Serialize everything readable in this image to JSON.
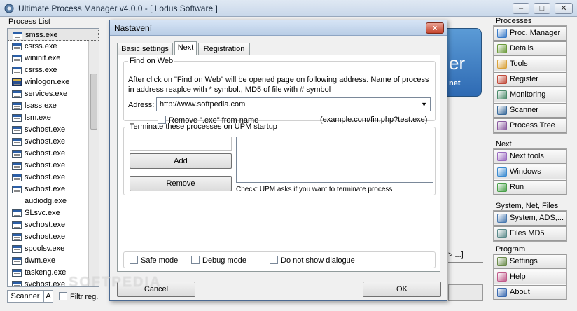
{
  "window": {
    "title": "Ultimate Process Manager v4.0.0 - [ Lodus Software ]"
  },
  "process_list": {
    "header": "Process List",
    "items": [
      {
        "name": "smss.exe",
        "icon": "process-icon"
      },
      {
        "name": "csrss.exe",
        "icon": "process-icon"
      },
      {
        "name": "wininit.exe",
        "icon": "process-icon"
      },
      {
        "name": "csrss.exe",
        "icon": "process-icon"
      },
      {
        "name": "winlogon.exe",
        "icon": "winlogon-icon"
      },
      {
        "name": "services.exe",
        "icon": "process-icon"
      },
      {
        "name": "lsass.exe",
        "icon": "process-icon"
      },
      {
        "name": "lsm.exe",
        "icon": "process-icon"
      },
      {
        "name": "svchost.exe",
        "icon": "process-icon"
      },
      {
        "name": "svchost.exe",
        "icon": "process-icon"
      },
      {
        "name": "svchost.exe",
        "icon": "process-icon"
      },
      {
        "name": "svchost.exe",
        "icon": "process-icon"
      },
      {
        "name": "svchost.exe",
        "icon": "process-icon"
      },
      {
        "name": "svchost.exe",
        "icon": "process-icon"
      },
      {
        "name": "audiodg.exe",
        "icon": ""
      },
      {
        "name": "SLsvc.exe",
        "icon": "process-icon"
      },
      {
        "name": "svchost.exe",
        "icon": "process-icon"
      },
      {
        "name": "svchost.exe",
        "icon": "process-icon"
      },
      {
        "name": "spoolsv.exe",
        "icon": "process-icon"
      },
      {
        "name": "dwm.exe",
        "icon": "process-icon"
      },
      {
        "name": "taskeng.exe",
        "icon": "process-icon"
      },
      {
        "name": "svchost.exe",
        "icon": "process-icon"
      }
    ],
    "scanner_label": "Scanner",
    "a_label": "A",
    "filter_label": "Filtr reg."
  },
  "background": {
    "logo_text": "er",
    "logo_sub": "net",
    "fragment": "> ...]"
  },
  "right_panel": {
    "groups": [
      {
        "label": "Processes",
        "items": [
          {
            "label": "Proc. Manager",
            "icon": "proc-manager-icon",
            "color": "#3a7bc8"
          },
          {
            "label": "Details",
            "icon": "details-icon",
            "color": "#6a9a3a"
          },
          {
            "label": "Tools",
            "icon": "tools-icon",
            "color": "#d9a23a"
          },
          {
            "label": "Register",
            "icon": "register-icon",
            "color": "#c04a3a"
          },
          {
            "label": "Monitoring",
            "icon": "monitoring-icon",
            "color": "#4a8a6a"
          },
          {
            "label": "Scanner",
            "icon": "scanner-icon",
            "color": "#3a6a9a"
          },
          {
            "label": "Process Tree",
            "icon": "process-tree-icon",
            "color": "#8a5aa0"
          }
        ]
      },
      {
        "label": "Next",
        "items": [
          {
            "label": "Next tools",
            "icon": "next-tools-icon",
            "color": "#9a6ac0"
          },
          {
            "label": "Windows",
            "icon": "windows-icon",
            "color": "#3a8ad0"
          },
          {
            "label": "Run",
            "icon": "run-icon",
            "color": "#4aa04a"
          }
        ]
      },
      {
        "label": "System, Net, Files",
        "items": [
          {
            "label": "System, ADS,...",
            "icon": "system-icon",
            "color": "#4a7ab0"
          },
          {
            "label": "Files MD5",
            "icon": "files-md5-icon",
            "color": "#5a8a8a"
          }
        ]
      },
      {
        "label": "Program",
        "items": [
          {
            "label": "Settings",
            "icon": "settings-icon",
            "color": "#6a8a4a"
          },
          {
            "label": "Help",
            "icon": "help-icon",
            "color": "#c05a8a"
          },
          {
            "label": "About",
            "icon": "about-icon",
            "color": "#3a6ab0"
          }
        ]
      }
    ]
  },
  "dialog": {
    "title": "Nastavení",
    "close_label": "x",
    "tabs": [
      "Basic settings",
      "Next",
      "Registration"
    ],
    "find_on_web": {
      "legend": "Find on Web",
      "description": "After click on \"Find on Web\" will be opened page on following address. Name of process in address reaplce with * symbol., MD5 of file with # symbol",
      "adress_label": "Adress:",
      "adress_value": "http://www.softpedia.com",
      "remove_exe_label": "Remove \".exe\" from name",
      "example": "(example.com/fin.php?test.exe)"
    },
    "terminate": {
      "legend": "Terminate these processes on UPM startup",
      "add_label": "Add",
      "remove_label": "Remove",
      "note": "Check: UPM asks if you want to terminate process"
    },
    "modes": {
      "safe_mode": "Safe mode",
      "debug_mode": "Debug mode",
      "no_dialogue": "Do not show dialogue"
    },
    "cancel_label": "Cancel",
    "ok_label": "OK"
  },
  "watermark": "SOFTPEDIA"
}
